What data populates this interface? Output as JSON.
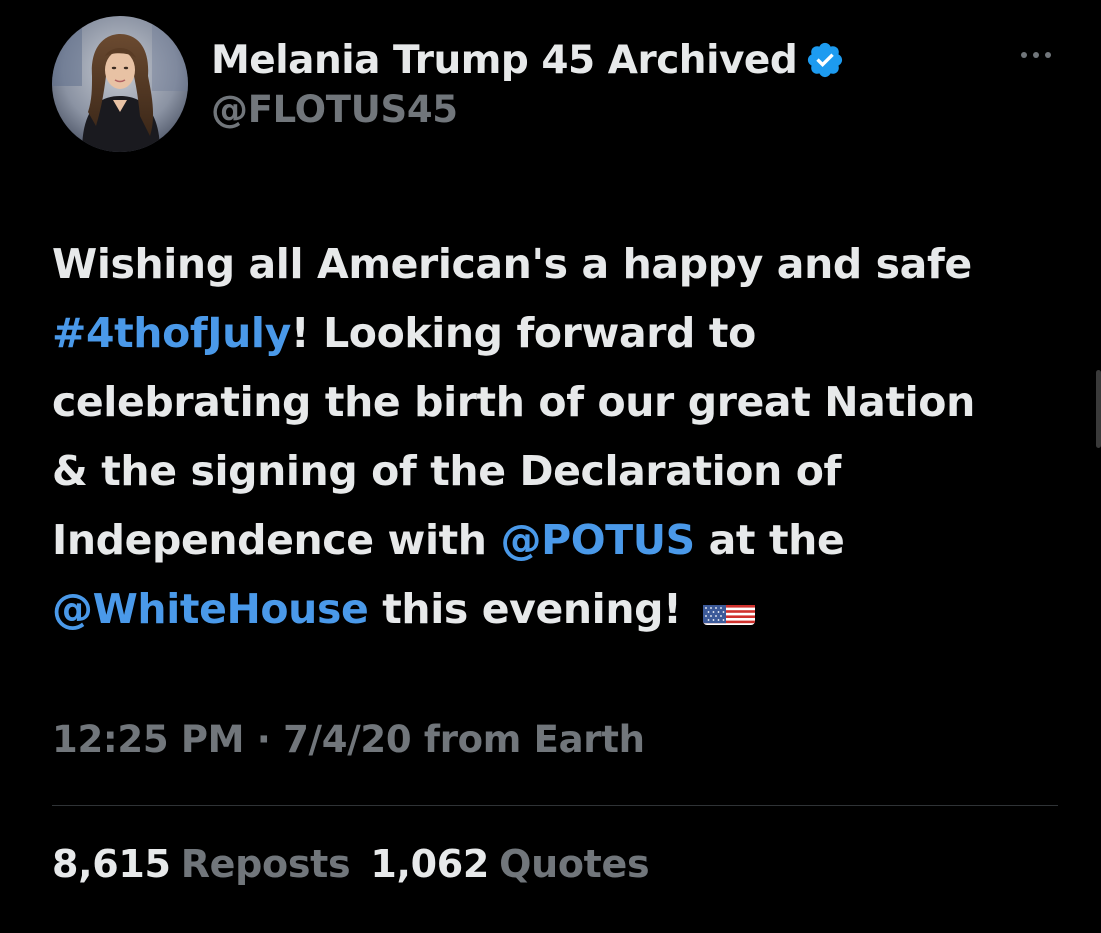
{
  "tweet": {
    "display_name": "Melania Trump 45 Archived",
    "handle": "@FLOTUS45",
    "verified_icon": "verified-badge-icon",
    "more_icon": "more-options-icon",
    "body": {
      "line1": "Wishing all American's a happy and safe",
      "hashtag": "#4thofJuly",
      "line2_rest": "! Looking forward to",
      "line3": "celebrating the birth of our great Nation",
      "line4": "& the signing of the Declaration of",
      "line5_pre": "Independence with ",
      "mention_potus": "@POTUS",
      "line5_post": " at the",
      "mention_whitehouse": "@WhiteHouse",
      "line6_post": " this evening!",
      "emoji": "us-flag-emoji"
    },
    "meta": "12:25 PM · 7/4/20 from Earth",
    "stats": {
      "reposts_count": "8,615",
      "reposts_label": "Reposts",
      "quotes_count": "1,062",
      "quotes_label": "Quotes"
    }
  },
  "colors": {
    "background": "#000000",
    "primary_text": "#e7e9ea",
    "secondary_text": "#71767b",
    "link": "#4a99e9",
    "verified": "#1d9bf0",
    "divider": "#2f3336"
  }
}
